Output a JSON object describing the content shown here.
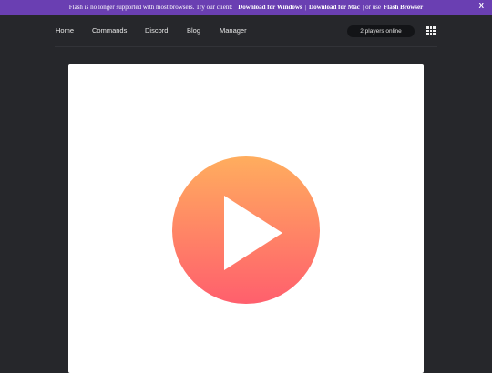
{
  "banner": {
    "message": "Flash is no longer supported with most browsers. Try our client:",
    "link_windows": "Download for Windows",
    "separator": "|",
    "link_mac": "Download for Mac",
    "middle": "| or use",
    "link_flash": "Flash Browser",
    "close_label": "X"
  },
  "nav": {
    "items": [
      "Home",
      "Commands",
      "Discord",
      "Blog",
      "Manager"
    ]
  },
  "status": {
    "players_online": "2 players online"
  },
  "icons": {
    "apps": "grid-icon",
    "play": "play-icon"
  },
  "colors": {
    "banner": "#6a3fb2",
    "background": "#26272b",
    "play_gradient_top": "#ffad5e",
    "play_gradient_bottom": "#ff5f6d"
  }
}
